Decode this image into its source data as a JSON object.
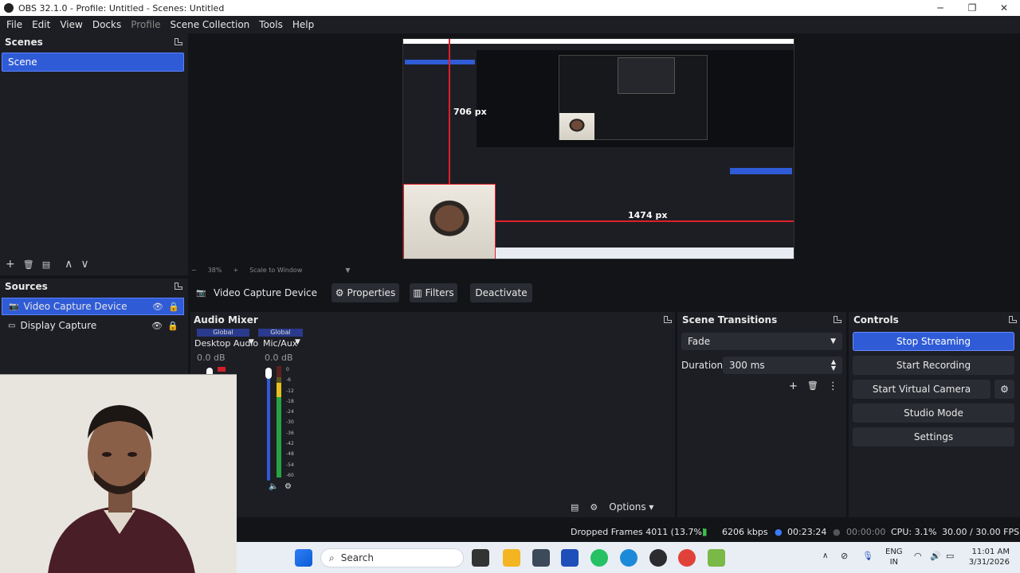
{
  "window": {
    "title": "OBS 32.1.0 - Profile: Untitled - Scenes: Untitled",
    "controls": [
      "─",
      "❐",
      "✕"
    ]
  },
  "menu": [
    "File",
    "Edit",
    "View",
    "Docks",
    "Profile",
    "Scene Collection",
    "Tools",
    "Help"
  ],
  "scenes": {
    "title": "Scenes",
    "items": [
      "Scene"
    ],
    "toolbar": [
      "+",
      "🗑",
      "▤",
      "∧",
      "∨"
    ]
  },
  "sources": {
    "title": "Sources",
    "items": [
      {
        "label": "Video Capture Device",
        "icon": "camera-icon",
        "selected": true
      },
      {
        "label": "Display Capture",
        "icon": "monitor-icon",
        "selected": false
      }
    ]
  },
  "preview": {
    "measure_v": "706 px",
    "measure_h": "1474 px",
    "zoom": "38%",
    "scale": "Scale to Window"
  },
  "source_toolbar": {
    "source_name": "Video Capture Device",
    "properties": "Properties",
    "filters": "Filters",
    "deactivate": "Deactivate"
  },
  "audio_mixer": {
    "title": "Audio Mixer",
    "channels": [
      {
        "tag": "Global",
        "name": "Desktop Audio",
        "db": "0.0 dB",
        "level": 0.0
      },
      {
        "tag": "Global",
        "name": "Mic/Aux",
        "db": "0.0 dB",
        "level": 0.85
      }
    ],
    "ticks": [
      "0",
      "-6",
      "-12",
      "-18",
      "-24",
      "-30",
      "-36",
      "-42",
      "-48",
      "-54",
      "-60"
    ],
    "options": "Options"
  },
  "transitions": {
    "title": "Scene Transitions",
    "selected": "Fade",
    "duration_label": "Duration",
    "duration": "300 ms"
  },
  "controls": {
    "title": "Controls",
    "buttons": [
      "Stop Streaming",
      "Start Recording",
      "Start Virtual Camera",
      "Studio Mode",
      "Settings"
    ]
  },
  "status": {
    "dropped": "Dropped Frames 4011 (13.7%)",
    "bitrate": "6206 kbps",
    "stream_time": "00:23:24",
    "rec_time": "00:00:00",
    "cpu": "CPU: 3.1%",
    "fps": "30.00 / 30.00 FPS"
  },
  "taskbar": {
    "search": "Search",
    "lang1": "ENG",
    "lang2": "IN",
    "time": "11:01 AM",
    "date": "3/31/2026"
  },
  "colors": {
    "accent": "#2f5bd6",
    "panel": "#1d1e24",
    "background": "#131418",
    "measure_line": "#e0202a"
  }
}
